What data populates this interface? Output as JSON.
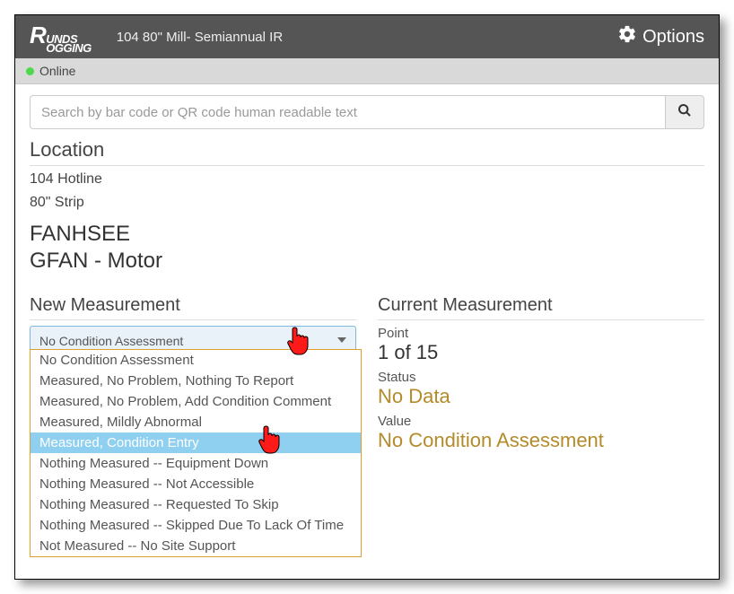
{
  "header": {
    "logo_top": "UNDS",
    "logo_bottom": "OGGING",
    "title": "104 80\" Mill- Semiannual IR",
    "options_label": "Options"
  },
  "status": {
    "text": "Online",
    "dot_color": "#4cd94c"
  },
  "search": {
    "placeholder": "Search by bar code or QR code human readable text"
  },
  "location": {
    "heading": "Location",
    "line1": "104 Hotline",
    "line2": "80\" Strip"
  },
  "equipment": {
    "name": "FANHSEE",
    "sub": "GFAN - Motor"
  },
  "new_measurement": {
    "heading": "New Measurement",
    "selected": "No Condition Assessment",
    "options": [
      "No Condition Assessment",
      "Measured, No Problem, Nothing To Report",
      "Measured, No Problem, Add Condition Comment",
      "Measured, Mildly Abnormal",
      "Measured, Condition Entry",
      "Nothing Measured -- Equipment Down",
      "Nothing Measured -- Not Accessible",
      "Nothing Measured -- Requested To Skip",
      "Nothing Measured -- Skipped Due To Lack Of Time",
      "Not Measured -- No Site Support"
    ],
    "highlight_index": 4
  },
  "current_measurement": {
    "heading": "Current Measurement",
    "point_label": "Point",
    "point_value": "1 of 15",
    "status_label": "Status",
    "status_value": "No Data",
    "value_label": "Value",
    "value_value": "No Condition Assessment"
  }
}
